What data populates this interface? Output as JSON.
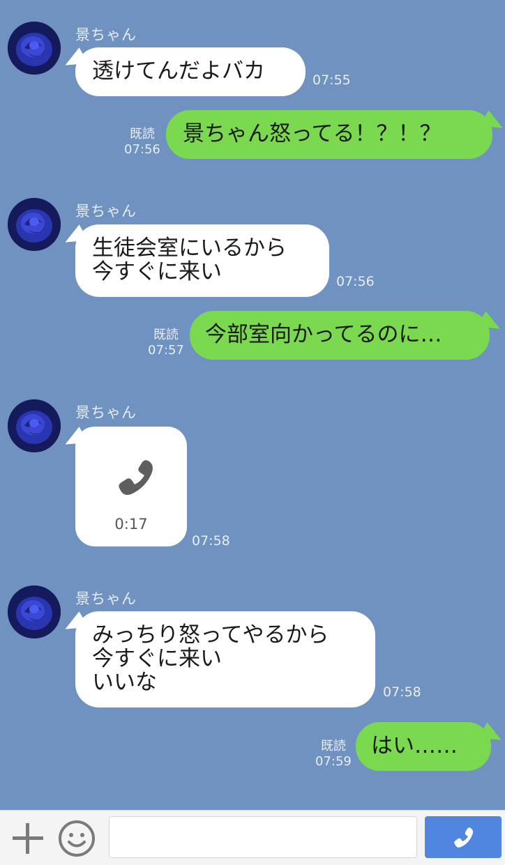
{
  "contact_name": "景ちゃん",
  "read_label": "既読",
  "messages": [
    {
      "type": "incoming",
      "sender": "景ちゃん",
      "text": "透けてんだよバカ",
      "time": "07:55"
    },
    {
      "type": "outgoing",
      "text": "景ちゃん怒ってる！？！？",
      "time": "07:56",
      "read": "既読"
    },
    {
      "type": "incoming",
      "sender": "景ちゃん",
      "text": "生徒会室にいるから\n今すぐに来い",
      "time": "07:56"
    },
    {
      "type": "outgoing",
      "text": "今部室向かってるのに…",
      "time": "07:57",
      "read": "既読"
    },
    {
      "type": "call",
      "sender": "景ちゃん",
      "duration": "0:17",
      "time": "07:58",
      "icon": "phone-icon"
    },
    {
      "type": "incoming",
      "sender": "景ちゃん",
      "text": "みっちり怒ってやるから\n今すぐに来い\nいいな",
      "time": "07:58"
    },
    {
      "type": "outgoing",
      "text": "はい……",
      "time": "07:59",
      "read": "既読"
    }
  ],
  "input_bar": {
    "plus_icon": "plus-icon",
    "emoji_icon": "smiley-icon",
    "placeholder": "",
    "send_icon": "phone-icon"
  },
  "colors": {
    "background": "#7092c0",
    "outgoing_bubble": "#7ad94f",
    "incoming_bubble": "#ffffff",
    "send_button": "#5186e0"
  }
}
